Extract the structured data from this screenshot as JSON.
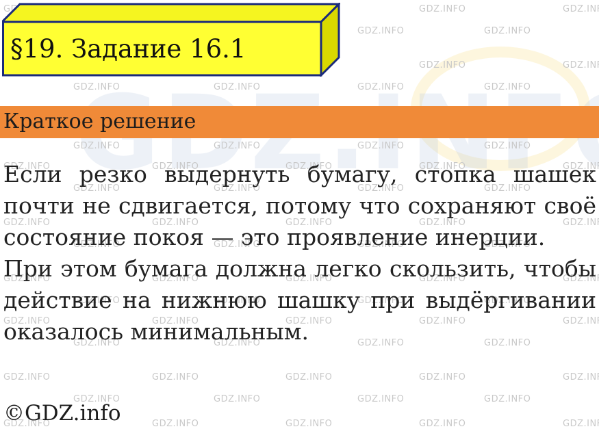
{
  "title": "§19. Задание 16.1",
  "section_heading": "Краткое решение",
  "paragraphs": [
    "Если резко выдернуть бумагу, стопка шашек почти не сдвигается, потому что сохраняют своё состояние покоя — это проявление инерции.",
    "При этом бумага должна легко скользить, чтобы действие на нижнюю шашку при выдёргивании оказалось минимальным."
  ],
  "footer": "©GDZ.info",
  "watermark": {
    "small_text": "GDZ.INFO",
    "big_text": "GDZ.INFO"
  },
  "colors": {
    "title_face": "#ffff33",
    "title_side": "#d9d900",
    "title_border": "#1a2a7a",
    "section_bar": "#f08a38",
    "text": "#222222",
    "watermark": "#c9c9c9"
  }
}
